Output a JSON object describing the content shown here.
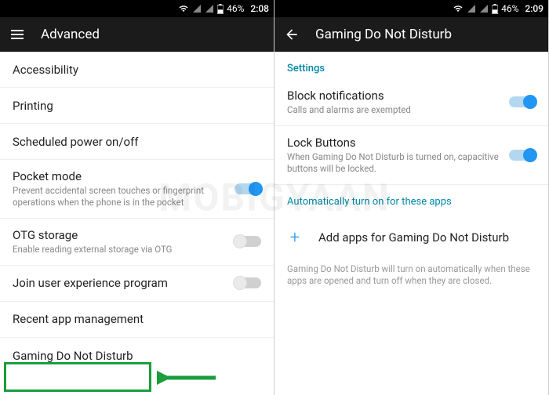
{
  "watermark": "MOBIGYAAN",
  "left": {
    "status": {
      "battery": "46%",
      "time": "2:08"
    },
    "appbar": {
      "title": "Advanced"
    },
    "items": [
      {
        "title": "Accessibility"
      },
      {
        "title": "Printing"
      },
      {
        "title": "Scheduled power on/off"
      },
      {
        "title": "Pocket mode",
        "subtitle": "Prevent accidental screen touches or fingerprint operations when the phone is in the pocket",
        "switch": "on"
      },
      {
        "title": "OTG storage",
        "subtitle": "Enable reading external storage via OTG",
        "switch": "off"
      },
      {
        "title": "Join user experience program",
        "switch": "off"
      },
      {
        "title": "Recent app management"
      },
      {
        "title": "Gaming Do Not Disturb"
      }
    ]
  },
  "right": {
    "status": {
      "battery": "46%",
      "time": "2:09"
    },
    "appbar": {
      "title": "Gaming Do Not Disturb"
    },
    "section_header": "Settings",
    "items": [
      {
        "title": "Block notifications",
        "subtitle": "Calls and alarms are exempted",
        "switch": "on"
      },
      {
        "title": "Lock Buttons",
        "subtitle": "When Gaming Do Not Disturb is turned on, capacitive buttons will be locked.",
        "switch": "on"
      }
    ],
    "auto_link": "Automatically turn on for these apps",
    "add_label": "Add apps for Gaming Do Not Disturb",
    "footnote": "Gaming Do Not Disturb will turn on automatically when these apps are opened and turn off when they are closed."
  }
}
